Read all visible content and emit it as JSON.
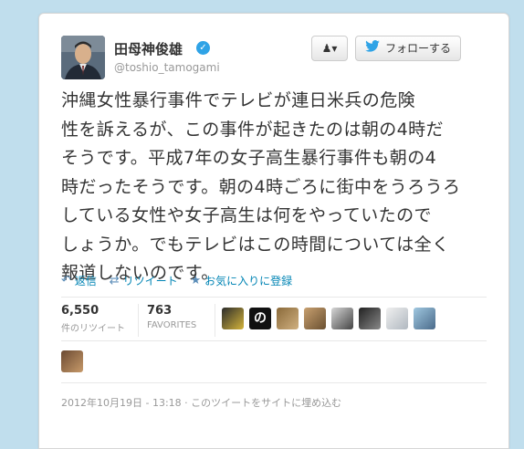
{
  "user": {
    "display_name": "田母神俊雄",
    "screen_name": "@toshio_tamogami"
  },
  "header": {
    "user_dropdown_label": "▾",
    "follow_label": "フォローする"
  },
  "tweet": {
    "lines": [
      "沖縄女性暴行事件でテレビが連日米兵の危険",
      "性を訴えるが、この事件が起きたのは朝の4時だ",
      "そうです。平成7年の女子高生暴行事件も朝の4",
      "時だったそうです。朝の4時ごろに街中をうろうろ",
      "している女性や女子高生は何をやっていたので",
      "しょうか。でもテレビはこの時間については全く",
      "報道しないのです。"
    ]
  },
  "actions": {
    "reply": "返信",
    "retweet": "リツイート",
    "favorite": "お気に入りに登録"
  },
  "stats": {
    "retweets_count": "6,550",
    "retweets_label": "件のリツイート",
    "favorites_count": "763",
    "favorites_label": "FAVORITES"
  },
  "footer": {
    "timestamp": "2012年10月19日 - 13:18",
    "separator": "·",
    "embed": "このツイートをサイトに埋め込む"
  },
  "colors": {
    "background": "#c0deed",
    "link": "#0084b4",
    "verified": "#2fa3e6"
  },
  "icons": {
    "reply": "reply-arrow-icon",
    "retweet": "retweet-icon",
    "favorite": "star-icon",
    "bird": "twitter-bird-icon",
    "verified": "verified-badge-icon",
    "user": "user-icon"
  }
}
